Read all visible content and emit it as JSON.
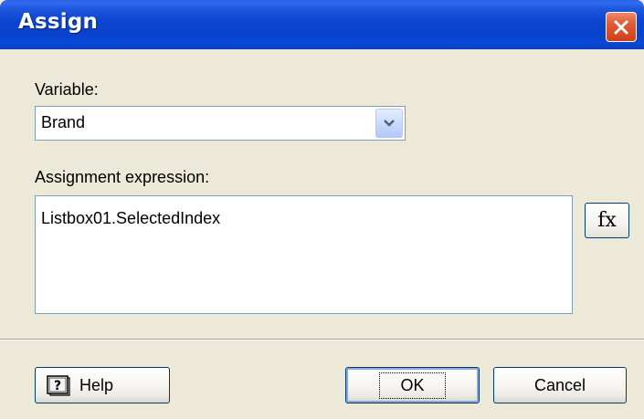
{
  "window": {
    "title": "Assign"
  },
  "variable": {
    "label": "Variable:",
    "selected": "Brand"
  },
  "assignment": {
    "label": "Assignment expression:",
    "value": "Listbox01.SelectedIndex",
    "fx_label": "fx"
  },
  "buttons": {
    "help_label": "Help",
    "ok_label": "OK",
    "cancel_label": "Cancel"
  },
  "icons": {
    "close": "close-icon",
    "dropdown": "chevron-down-icon",
    "help": "help-book-icon"
  },
  "colors": {
    "titlebar": "#0a44d0",
    "close_button": "#e05a36",
    "dialog_bg": "#ece9d8",
    "field_border": "#7f9db9"
  }
}
